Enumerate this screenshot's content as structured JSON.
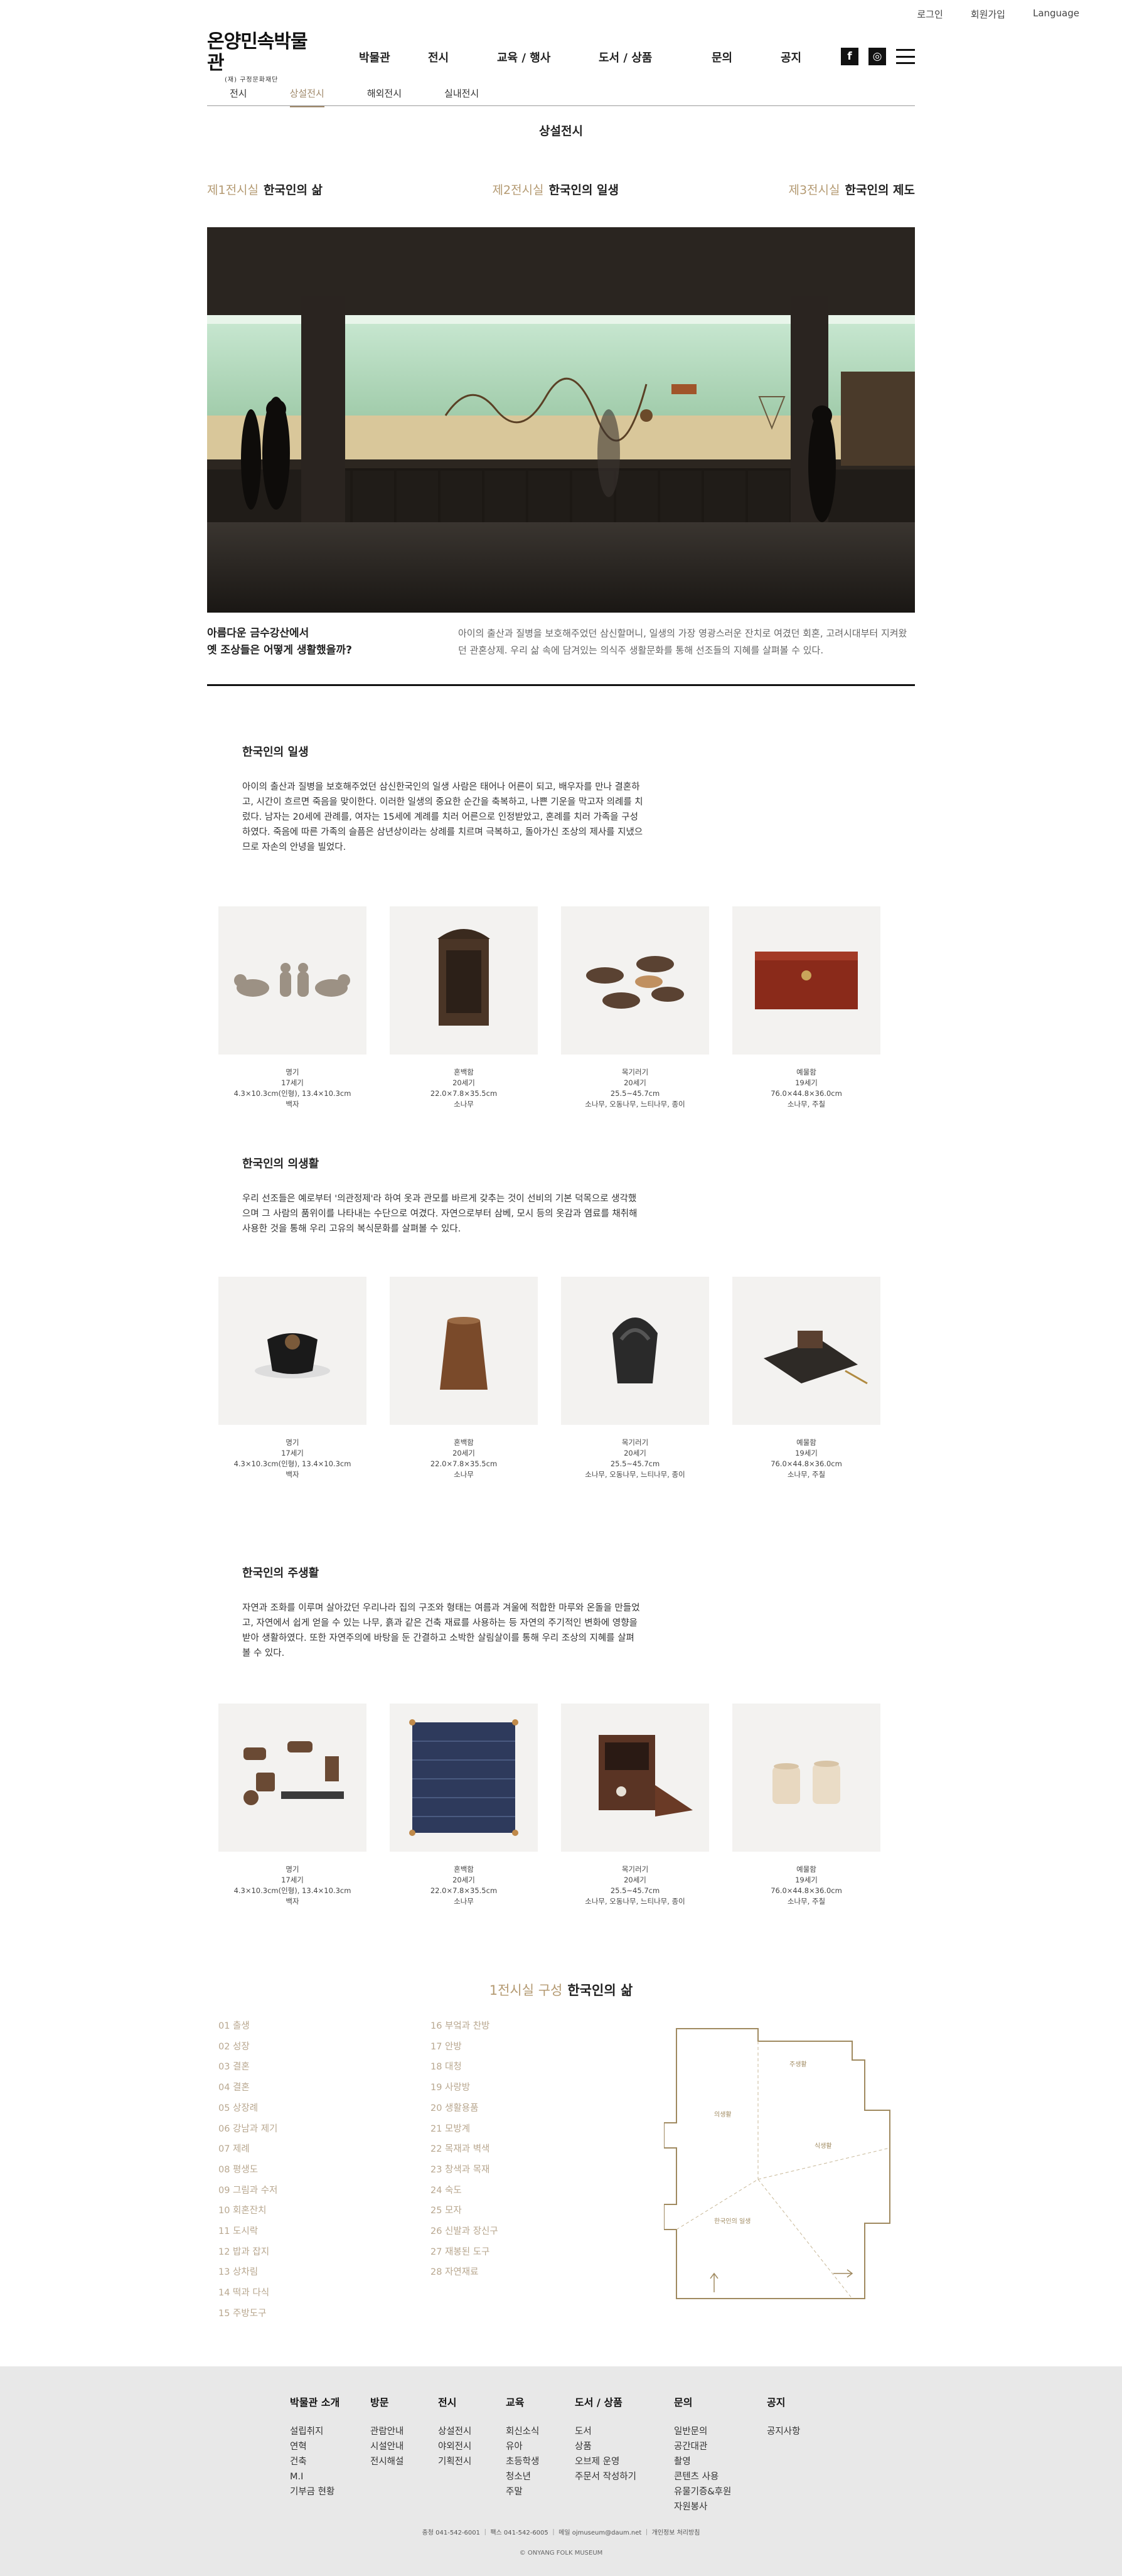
{
  "util": [
    "로그인",
    "회원가입",
    "Language"
  ],
  "logo": {
    "main": "온양민속박물관",
    "sub": "(재) 구정문화재단"
  },
  "gnb": [
    "박물관",
    "전시",
    "교육 / 행사",
    "도서 / 상품",
    "문의",
    "공지"
  ],
  "social": {
    "facebook": "f",
    "instagram": "◎"
  },
  "subnav": {
    "items": [
      "전시",
      "상설전시",
      "해외전시",
      "실내전시"
    ],
    "active_index": 1
  },
  "page_title": "상설전시",
  "halls": [
    {
      "num": "제1전시실",
      "name": "한국인의 삶"
    },
    {
      "num": "제2전시실",
      "name": "한국인의 일생"
    },
    {
      "num": "제3전시실",
      "name": "한국인의 제도"
    }
  ],
  "intro": {
    "heading": "아름다운 금수강산에서\n옛 조상들은 어떻게 생활했을까?",
    "text": "아이의 출산과 질병을 보호해주었던 삼신할머니, 일생의 가장 영광스러운 잔치로 여겼던 회혼, 고려시대부터 지켜왔던 관혼상제. 우리 삶 속에 담겨있는 의식주 생활문화를 통해 선조들의 지혜를 살펴볼 수 있다."
  },
  "sections": [
    {
      "title": "한국인의 일생",
      "text": "아이의 출산과 질병을 보호해주었던 삼신한국인의 일생\n사람은 태어나 어른이 되고, 배우자를 만나 결혼하고, 시간이 흐르면 죽음을 맞이한다. 이러한 일생의 중요한 순간을 축복하고, 나쁜 기운을 막고자 의례를 치렀다. 남자는 20세에 관례를, 여자는 15세에 계례를 치러 어른으로 인정받았고, 혼례를 치러 가족을 구성하였다. 죽음에 따른 가족의 슬픔은 삼년상이라는 상례를 치르며 극복하고, 돌아가신 조상의 제사를 지냈으므로 자손의 안녕을 빌었다.",
      "items": [
        {
          "name": "명기",
          "era": "17세기",
          "size": "4.3×10.3cm(인형), 13.4×10.3cm",
          "material": "백자"
        },
        {
          "name": "혼백함",
          "era": "20세기",
          "size": "22.0×7.8×35.5cm",
          "material": "소나무"
        },
        {
          "name": "목기러기",
          "era": "20세기",
          "size": "25.5~45.7cm",
          "material": "소나무, 오동나무, 느티나무, 종이"
        },
        {
          "name": "예물함",
          "era": "19세기",
          "size": "76.0×44.8×36.0cm",
          "material": "소나무, 주칠"
        }
      ]
    },
    {
      "title": "한국인의 의생활",
      "text": "우리 선조들은 예로부터 '의관정제'라 하여 옷과 관모를 바르게 갖추는 것이 선비의 기본 덕목으로 생각했으며 그 사람의 품위이를 나타내는 수단으로 여겼다. 자연으로부터 삼베, 모시 등의 옷감과 염료를 채취해 사용한 것을 통해 우리 고유의 복식문화를 살펴볼 수 있다.",
      "items": [
        {
          "name": "명기",
          "era": "17세기",
          "size": "4.3×10.3cm(인형), 13.4×10.3cm",
          "material": "백자"
        },
        {
          "name": "혼백함",
          "era": "20세기",
          "size": "22.0×7.8×35.5cm",
          "material": "소나무"
        },
        {
          "name": "목기러기",
          "era": "20세기",
          "size": "25.5~45.7cm",
          "material": "소나무, 오동나무, 느티나무, 종이"
        },
        {
          "name": "예물함",
          "era": "19세기",
          "size": "76.0×44.8×36.0cm",
          "material": "소나무, 주칠"
        }
      ]
    },
    {
      "title": "한국인의 주생활",
      "text": "자연과 조화를 이루며 살아갔던 우리나라 집의 구조와 형태는 여름과 겨울에 적합한 마루와 온돌을 만들었고, 자연에서 쉽게 얻을 수 있는 나무, 흙과 같은 건축 재료를 사용하는 등 자연의 주기적인 변화에 영향을 받아 생활하였다. 또한 자연주의에 바탕을 둔 간결하고 소박한 살림살이를 통해 우리 조상의 지혜를 살펴 볼 수 있다.",
      "items": [
        {
          "name": "명기",
          "era": "17세기",
          "size": "4.3×10.3cm(인형), 13.4×10.3cm",
          "material": "백자"
        },
        {
          "name": "혼백함",
          "era": "20세기",
          "size": "22.0×7.8×35.5cm",
          "material": "소나무"
        },
        {
          "name": "목기러기",
          "era": "20세기",
          "size": "25.5~45.7cm",
          "material": "소나무, 오동나무, 느티나무, 종이"
        },
        {
          "name": "예물함",
          "era": "19세기",
          "size": "76.0×44.8×36.0cm",
          "material": "소나무, 주칠"
        }
      ]
    }
  ],
  "composition": {
    "num": "1전시실 구성",
    "name": "한국인의 삶",
    "col1": [
      "01 출생",
      "02 성장",
      "03 결혼",
      "04 결혼",
      "05 상장례",
      "06 강남과 제기",
      "07 제례",
      "08 평생도",
      "09 그림과 수저",
      "10 회혼잔치",
      "11 도시락",
      "12 밥과 잡지",
      "13 상차림",
      "14 떡과 다식",
      "15 주방도구"
    ],
    "col2": [
      "16 부엌과 찬방",
      "17 안방",
      "18 대청",
      "19 사랑방",
      "20 생활용품",
      "21 모방계",
      "22 목재과 벽색",
      "23 창색과 목재",
      "24 숙도",
      "25 모자",
      "26 신발과 장신구",
      "27 재봉된 도구",
      "28 자연재료"
    ],
    "floor_labels": [
      "주생활",
      "의생활",
      "식생활",
      "한국인의 일생"
    ]
  },
  "footer": {
    "columns": [
      {
        "h": "박물관 소개",
        "items": [
          "설립취지",
          "연혁",
          "건축",
          "M.I",
          "기부금 현황"
        ]
      },
      {
        "h": "방문",
        "items": [
          "관람안내",
          "시설안내",
          "전시해설"
        ]
      },
      {
        "h": "전시",
        "items": [
          "상설전시",
          "야외전시",
          "기획전시"
        ]
      },
      {
        "h": "교육",
        "items": [
          "회신소식",
          "유아",
          "초등학생",
          "청소년",
          "주말"
        ]
      },
      {
        "h": "도서 / 상품",
        "items": [
          "도서",
          "상품",
          "오브제 운영",
          "주문서 작성하기"
        ]
      },
      {
        "h": "문의",
        "items": [
          "일반문의",
          "공간대관",
          "촬영",
          "콘텐츠 사용",
          "유물기증&후원",
          "자원봉사"
        ]
      },
      {
        "h": "공지",
        "items": [
          "공지사항"
        ]
      }
    ],
    "info": "충청 041-542-6001 ｜ 팩스 041-542-6005 ｜ 메일 ojmuseum@daum.net ｜ 개인정보 처리방침",
    "copyright": "© ONYANG FOLK MUSEUM"
  }
}
